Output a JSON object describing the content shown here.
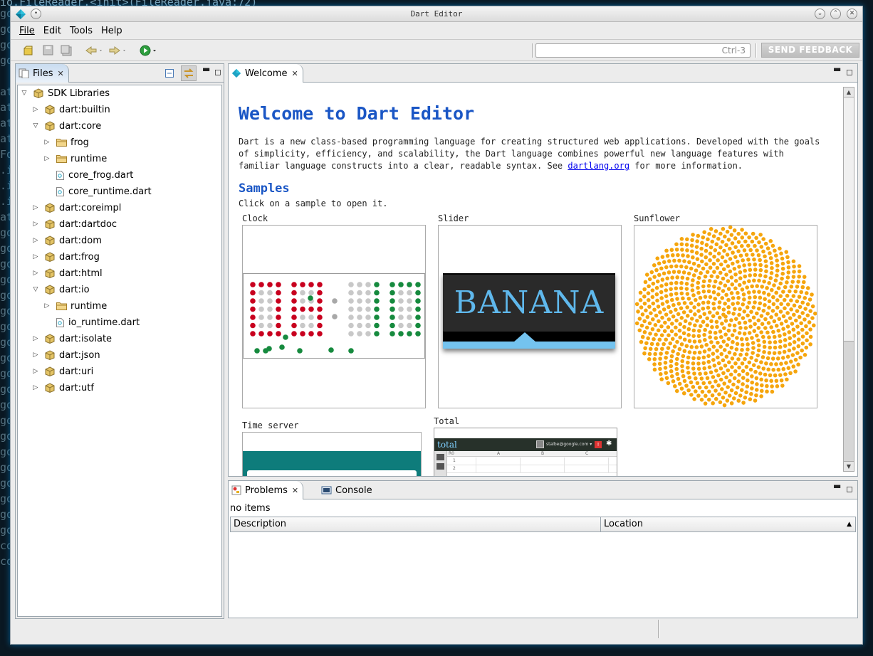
{
  "background": {
    "terminal_text": "io.FileReader.<init>(FileReader.java:72)",
    "terminal_margin": "go\ngo\ngo\ngo\n\nat\nat\nat\nat\nFo\n.i\n.i\n.i\nat\ngo\ngo\ngo\ngo\ngo\ngo\ngo\ngo\ngo\ngo\ngo\ngo\ngo\ngo\ngo\ngo\ngo\ngo\ngo\ngo\nco\nco"
  },
  "window": {
    "title": "Dart Editor"
  },
  "menu": [
    "File",
    "Edit",
    "Tools",
    "Help"
  ],
  "toolbar": {
    "quick_access_hint": "Ctrl-3",
    "feedback_label": "SEND FEEDBACK"
  },
  "files_view": {
    "tab_label": "Files",
    "tree": [
      {
        "label": "SDK Libraries",
        "level": 0,
        "kind": "library-root",
        "expanded": true
      },
      {
        "label": "dart:builtin",
        "level": 1,
        "kind": "package",
        "expanded": false
      },
      {
        "label": "dart:core",
        "level": 1,
        "kind": "package",
        "expanded": true
      },
      {
        "label": "frog",
        "level": 2,
        "kind": "folder",
        "expanded": false
      },
      {
        "label": "runtime",
        "level": 2,
        "kind": "folder",
        "expanded": false
      },
      {
        "label": "core_frog.dart",
        "level": 2,
        "kind": "file"
      },
      {
        "label": "core_runtime.dart",
        "level": 2,
        "kind": "file"
      },
      {
        "label": "dart:coreimpl",
        "level": 1,
        "kind": "package",
        "expanded": false
      },
      {
        "label": "dart:dartdoc",
        "level": 1,
        "kind": "package",
        "expanded": false
      },
      {
        "label": "dart:dom",
        "level": 1,
        "kind": "package",
        "expanded": false
      },
      {
        "label": "dart:frog",
        "level": 1,
        "kind": "package",
        "expanded": false
      },
      {
        "label": "dart:html",
        "level": 1,
        "kind": "package",
        "expanded": false
      },
      {
        "label": "dart:io",
        "level": 1,
        "kind": "package",
        "expanded": true
      },
      {
        "label": "runtime",
        "level": 2,
        "kind": "folder",
        "expanded": false
      },
      {
        "label": "io_runtime.dart",
        "level": 2,
        "kind": "file"
      },
      {
        "label": "dart:isolate",
        "level": 1,
        "kind": "package",
        "expanded": false
      },
      {
        "label": "dart:json",
        "level": 1,
        "kind": "package",
        "expanded": false
      },
      {
        "label": "dart:uri",
        "level": 1,
        "kind": "package",
        "expanded": false
      },
      {
        "label": "dart:utf",
        "level": 1,
        "kind": "package",
        "expanded": false
      }
    ]
  },
  "welcome": {
    "tab_label": "Welcome",
    "title": "Welcome to Dart Editor",
    "desc_before": "Dart is a new class-based programming language for creating structured web applications. Developed with the goals of simplicity, efficiency, and scalability, the Dart language combines powerful new language features with familiar language constructs into a clear, readable syntax. See ",
    "desc_link": "dartlang.org",
    "desc_after": " for more information.",
    "samples_heading": "Samples",
    "samples_sub": "Click on a sample to open it.",
    "samples": {
      "clock": "Clock",
      "slider": "Slider",
      "slider_word": "BANANA",
      "sunflower": "Sunflower",
      "time_server": "Time server",
      "total": "Total",
      "total_brand": "total",
      "total_user": "stalbe@google.com ▾",
      "total_cols": [
        "A",
        "B",
        "C"
      ],
      "total_rows": [
        "1",
        "2"
      ],
      "total_corner": "R0"
    }
  },
  "problems_view": {
    "tab_label": "Problems",
    "console_tab_label": "Console",
    "status": "no items",
    "columns": [
      "Description",
      "Location"
    ]
  },
  "colors": {
    "accent_blue": "#1a56c5",
    "clock_red": "#c8001e",
    "clock_green": "#168a3e",
    "sunflower_orange": "#f5a50d",
    "total_header": "#27312a",
    "time_server_teal": "#0e7c7b"
  }
}
